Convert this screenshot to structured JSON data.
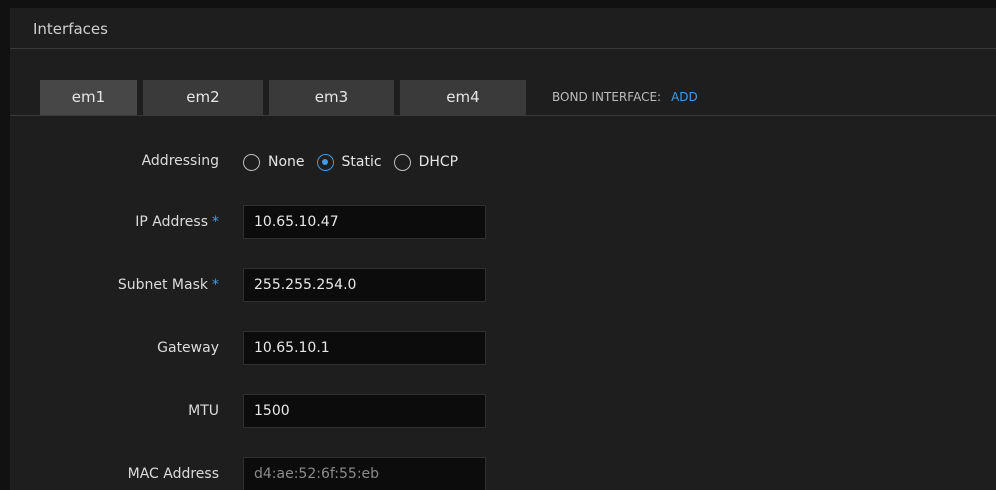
{
  "panel": {
    "title": "Interfaces"
  },
  "tabs": [
    {
      "label": "em1",
      "active": true
    },
    {
      "label": "em2",
      "active": false
    },
    {
      "label": "em3",
      "active": false
    },
    {
      "label": "em4",
      "active": false
    }
  ],
  "bond": {
    "label": "BOND INTERFACE:",
    "add_label": "ADD"
  },
  "form": {
    "addressing": {
      "label": "Addressing",
      "options": [
        {
          "label": "None",
          "checked": false
        },
        {
          "label": "Static",
          "checked": true
        },
        {
          "label": "DHCP",
          "checked": false
        }
      ]
    },
    "ip_address": {
      "label": "IP Address",
      "required_marker": "*",
      "value": "10.65.10.47"
    },
    "subnet_mask": {
      "label": "Subnet Mask",
      "required_marker": "*",
      "value": "255.255.254.0"
    },
    "gateway": {
      "label": "Gateway",
      "value": "10.65.10.1"
    },
    "mtu": {
      "label": "MTU",
      "value": "1500"
    },
    "mac_address": {
      "label": "MAC Address",
      "value": "d4:ae:52:6f:55:eb"
    }
  },
  "colors": {
    "accent": "#3f9be6",
    "panel_bg": "#1e1e1e",
    "tab_bg": "#3a3a3a",
    "field_bg": "#0c0c0c"
  }
}
